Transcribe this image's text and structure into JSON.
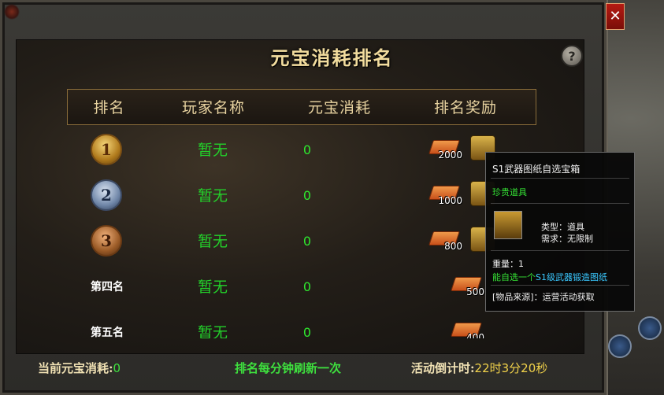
{
  "window": {
    "title": "元宝消耗排名",
    "close_label": "✕",
    "help_label": "?"
  },
  "table": {
    "headers": [
      "排名",
      "玩家名称",
      "元宝消耗",
      "排名奖励"
    ],
    "rows": [
      {
        "rank": "1",
        "player": "暂无",
        "consume": "0",
        "reward_count": "2000"
      },
      {
        "rank": "2",
        "player": "暂无",
        "consume": "0",
        "reward_count": "1000"
      },
      {
        "rank": "3",
        "player": "暂无",
        "consume": "0",
        "reward_count": "800"
      },
      {
        "rank": "第四名",
        "player": "暂无",
        "consume": "0",
        "reward_count": "500"
      },
      {
        "rank": "第五名",
        "player": "暂无",
        "consume": "0",
        "reward_count": "400"
      }
    ]
  },
  "tooltip": {
    "title": "S1武器图纸自选宝箱",
    "quality": "珍贵道具",
    "type_label": "类型：道具",
    "req_label": "需求：无限制",
    "weight": "重量：1",
    "desc_prefix": "能自选一个",
    "desc_highlight": "S1级武器锻造图纸",
    "source": "[物品来源]：运营活动获取"
  },
  "footer": {
    "current_label": "当前元宝消耗:",
    "current_value": "0",
    "refresh_note": "排名每分钟刷新一次",
    "countdown_label": "活动倒计时:",
    "countdown_value": "22时3分20秒"
  },
  "colors": {
    "accent_gold": "#f2dc9e",
    "green": "#23d12a",
    "yellow": "#f1d24a"
  }
}
